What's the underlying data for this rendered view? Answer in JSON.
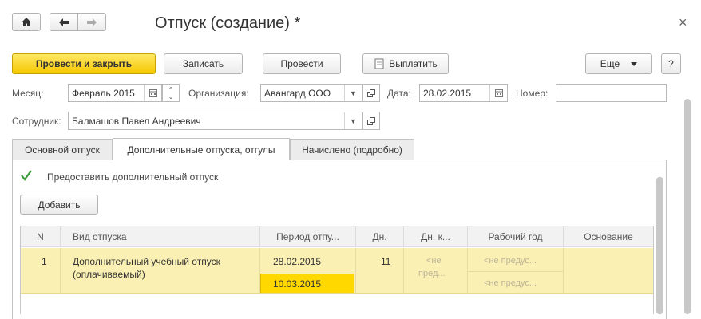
{
  "window": {
    "title": "Отпуск (создание) *",
    "close": "×"
  },
  "nav": {
    "home": "home-icon",
    "back": "arrow-left-icon",
    "forward": "arrow-right-icon"
  },
  "toolbar": {
    "post_close": "Провести и закрыть",
    "save": "Записать",
    "post": "Провести",
    "pay": "Выплатить",
    "more": "Еще",
    "help": "?"
  },
  "form": {
    "month_label": "Месяц:",
    "month_value": "Февраль 2015",
    "org_label": "Организация:",
    "org_value": "Авангард ООО",
    "date_label": "Дата:",
    "date_value": "28.02.2015",
    "number_label": "Номер:",
    "number_value": "",
    "employee_label": "Сотрудник:",
    "employee_value": "Балмашов Павел Андреевич"
  },
  "tabs": [
    {
      "label": "Основной отпуск"
    },
    {
      "label": "Дополнительные отпуска, отгулы"
    },
    {
      "label": "Начислено (подробно)"
    }
  ],
  "panel": {
    "checkbox_label": "Предоставить дополнительный отпуск",
    "checkbox_checked": true,
    "add_button": "Добавить"
  },
  "table": {
    "headers": [
      "N",
      "Вид отпуска",
      "Период отпу...",
      "Дн.",
      "Дн. к...",
      "Рабочий год",
      "Основание"
    ],
    "rows": [
      {
        "n": "1",
        "type_line1": "Дополнительный учебный отпуск",
        "type_line2": "(оплачиваемый)",
        "period_from": "28.02.2015",
        "period_to": "10.03.2015",
        "days": "11",
        "days_k_line1": "<не",
        "days_k_line2": "пред...",
        "work_year_1": "<не предус...",
        "work_year_2": "<не предус...",
        "basis": ""
      }
    ]
  },
  "colors": {
    "accent": "#f5c800",
    "row_highlight": "#fbf0b3",
    "selected_cell": "#ffd800"
  }
}
